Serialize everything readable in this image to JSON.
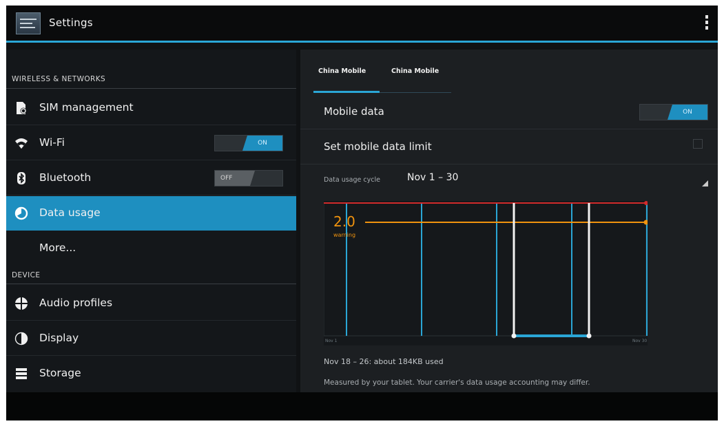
{
  "app": {
    "title": "Settings"
  },
  "left": {
    "sections": [
      {
        "header": "WIRELESS & NETWORKS"
      },
      {
        "header": "DEVICE"
      }
    ],
    "items": [
      {
        "label": "SIM management",
        "icon": "sim-card-icon"
      },
      {
        "label": "Wi-Fi",
        "icon": "wifi-icon",
        "toggle": "ON"
      },
      {
        "label": "Bluetooth",
        "icon": "bluetooth-icon",
        "toggle": "OFF"
      },
      {
        "label": "Data usage",
        "icon": "data-usage-icon",
        "selected": true
      },
      {
        "label": "More..."
      },
      {
        "label": "Audio profiles",
        "icon": "audio-profiles-icon"
      },
      {
        "label": "Display",
        "icon": "display-icon"
      },
      {
        "label": "Storage",
        "icon": "storage-icon"
      }
    ]
  },
  "right": {
    "tabs": [
      "China Mobile",
      "China Mobile"
    ],
    "mobile_data": {
      "label": "Mobile data",
      "toggle": "ON"
    },
    "set_limit": {
      "label": "Set mobile data limit"
    },
    "cycle": {
      "label": "Data usage cycle",
      "value": "Nov 1 – 30"
    },
    "summary": "Nov 18 – 26: about 184KB used",
    "note": "Measured by your tablet. Your carrier's data usage accounting may differ."
  },
  "chart_data": {
    "type": "line",
    "warning_value": "2.0",
    "warning_label": "warning",
    "x_start_label": "Nov 1",
    "x_end_label": "Nov 30",
    "span_start_label": "Nov 18",
    "span_end_label": "Nov 26"
  },
  "colors": {
    "accent": "#2aa6d6",
    "selected_bg": "#1e8fc0",
    "limit_line": "#d22b2b",
    "warning_line": "#f0930e"
  }
}
